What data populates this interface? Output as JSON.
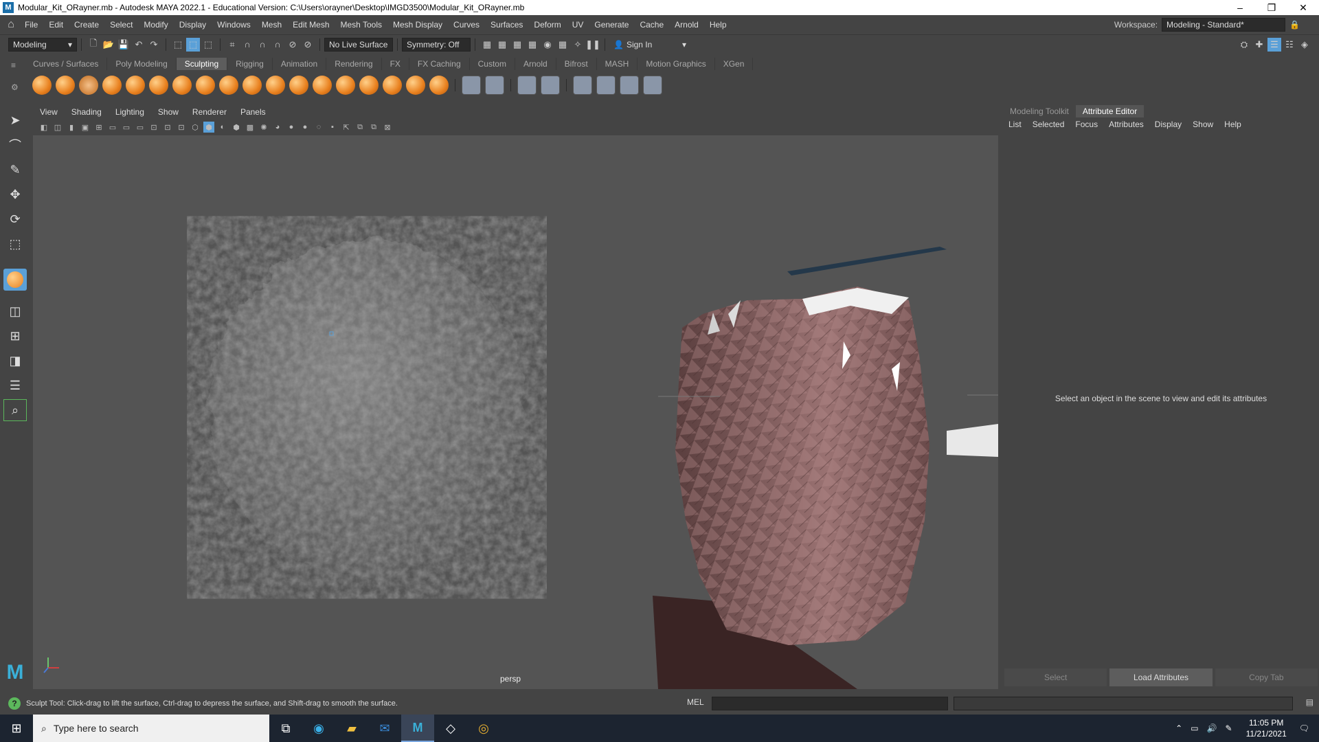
{
  "window": {
    "title": "Modular_Kit_ORayner.mb - Autodesk MAYA 2022.1 - Educational Version: C:\\Users\\orayner\\Desktop\\IMGD3500\\Modular_Kit_ORayner.mb"
  },
  "menubar": {
    "items": [
      "File",
      "Edit",
      "Create",
      "Select",
      "Modify",
      "Display",
      "Windows",
      "Mesh",
      "Edit Mesh",
      "Mesh Tools",
      "Mesh Display",
      "Curves",
      "Surfaces",
      "Deform",
      "UV",
      "Generate",
      "Cache",
      "Arnold",
      "Help"
    ],
    "workspace_label": "Workspace:",
    "workspace_value": "Modeling - Standard*"
  },
  "statusline": {
    "mode": "Modeling",
    "live_surface": "No Live Surface",
    "symmetry": "Symmetry: Off",
    "sign_in": "Sign In"
  },
  "shelf": {
    "tabs": [
      "Curves / Surfaces",
      "Poly Modeling",
      "Sculpting",
      "Rigging",
      "Animation",
      "Rendering",
      "FX",
      "FX Caching",
      "Custom",
      "Arnold",
      "Bifrost",
      "MASH",
      "Motion Graphics",
      "XGen"
    ],
    "active_tab": "Sculpting"
  },
  "viewport": {
    "menu": [
      "View",
      "Shading",
      "Lighting",
      "Show",
      "Renderer",
      "Panels"
    ],
    "camera": "persp"
  },
  "right_panel": {
    "tabs": [
      "Modeling Toolkit",
      "Attribute Editor"
    ],
    "active_tab": "Attribute Editor",
    "menu": [
      "List",
      "Selected",
      "Focus",
      "Attributes",
      "Display",
      "Show",
      "Help"
    ],
    "message": "Select an object in the scene to view and edit its attributes",
    "buttons": [
      "Select",
      "Load Attributes",
      "Copy Tab"
    ]
  },
  "helpline": {
    "text": "Sculpt Tool: Click-drag to lift the surface, Ctrl-drag to depress the surface, and Shift-drag to smooth the surface.",
    "mel_label": "MEL"
  },
  "taskbar": {
    "search_placeholder": "Type here to search",
    "time": "11:05 PM",
    "date": "11/21/2021"
  },
  "colors": {
    "ui_bg": "#444444",
    "viewport_bg": "#545454",
    "accent": "#5aa0d8",
    "rock": "#6a6a6a",
    "mesh": "#8a6464"
  }
}
